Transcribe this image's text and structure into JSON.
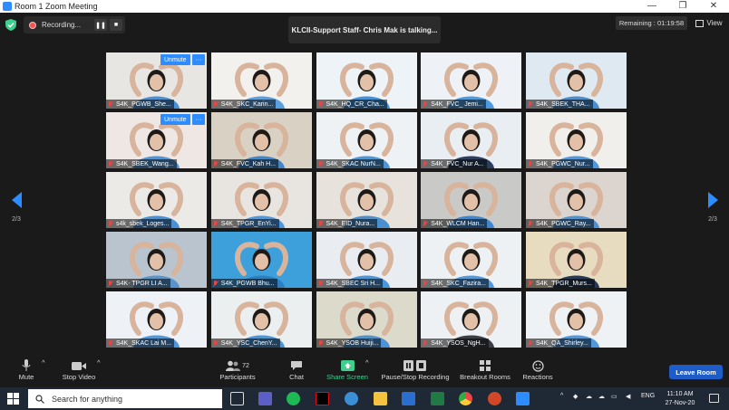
{
  "window": {
    "title": "Room 1   Zoom Meeting"
  },
  "top": {
    "recording_label": "Recording...",
    "talking_banner": "KLCII-Support Staff- Chris Mak is talking...",
    "remaining": "Remaining : 01:19:58",
    "view_label": "View"
  },
  "nav": {
    "page_left": "2/3",
    "page_right": "2/3"
  },
  "participants": [
    {
      "name": "S4K_PGWB_She...",
      "unmute": "Unmute",
      "more": "···",
      "bg": "#e8e6e2",
      "shirt": "#4a90d9"
    },
    {
      "name": "S4K_SKC_Karin...",
      "bg": "#f3f1ee",
      "shirt": "#5aa0e0"
    },
    {
      "name": "S4K_HQ_CR_Cha...",
      "bg": "#eef3f7",
      "shirt": "#3d92e0"
    },
    {
      "name": "S4K_FVC_ Jemi...",
      "bg": "#eef2f6",
      "shirt": "#4b9be3"
    },
    {
      "name": "S4K_SBEK_THA...",
      "bg": "#dfe9f2",
      "shirt": "#4a8ed0"
    },
    {
      "name": "S4K_SBEK_Wang...",
      "unmute": "Unmute",
      "more": "···",
      "bg": "#efe7e4",
      "shirt": "#4e94d8"
    },
    {
      "name": "S4K_FVC_Kah H...",
      "bg": "#d9d1c4",
      "shirt": "#3f86cc"
    },
    {
      "name": "S4K_SKAC NurN...",
      "bg": "#eef2f5",
      "shirt": "#4a94da"
    },
    {
      "name": "S4K_FVC_Nur A...",
      "bg": "#e9eef2",
      "shirt": "#2c3e60"
    },
    {
      "name": "S4K_PGWC_Nur...",
      "bg": "#f1efec",
      "shirt": "#4f98dd"
    },
    {
      "name": "s4k_sbek_Loges...",
      "bg": "#eceae7",
      "shirt": "#4a90d9"
    },
    {
      "name": "S4K_TPGR_EnYi...",
      "bg": "#e8e4df",
      "shirt": "#4e98de"
    },
    {
      "name": "S4K_EID_Nura...",
      "bg": "#e7e3dc",
      "shirt": "#4b8fcf"
    },
    {
      "name": "S4K_WLCM Han...",
      "bg": "#c9c9c7",
      "shirt": "#3b87d4"
    },
    {
      "name": "S4K_PGWC_Ray...",
      "bg": "#dcd4ce",
      "shirt": "#4b93d6"
    },
    {
      "name": "S4K- TPGR LI A...",
      "bg": "#b9c4cf",
      "shirt": "#5a94cc"
    },
    {
      "name": "S4K_PGWB Bhu...",
      "bg": "#3da0da",
      "shirt": "#2f7fc0"
    },
    {
      "name": "S4K_SBEC Sri H...",
      "bg": "#e9edf1",
      "shirt": "#4b96db"
    },
    {
      "name": "S4K_SKC_Fazira...",
      "bg": "#edf1f4",
      "shirt": "#4f9ae0"
    },
    {
      "name": "S4K_TPGR_Murs...",
      "bg": "#e8dcc0",
      "shirt": "#273b58"
    },
    {
      "name": "S4K_SKAC Lai M...",
      "bg": "#eef2f6",
      "shirt": "#4f98dd"
    },
    {
      "name": "S4K_YSC_ChenY...",
      "bg": "#ecefef",
      "shirt": "#4b95da"
    },
    {
      "name": "S4K_YSOB Huiji...",
      "bg": "#dcdacb",
      "shirt": "#4d92d2"
    },
    {
      "name": "S4K_YSOS_NgH...",
      "bg": "#eef1f4",
      "shirt": "#3b3f45"
    },
    {
      "name": "S4K_QA_Shirley...",
      "bg": "#eef2f5",
      "shirt": "#4f98dd"
    }
  ],
  "toolbar": {
    "mute": "Mute",
    "stop_video": "Stop Video",
    "participants": "Participants",
    "participants_count": "72",
    "chat": "Chat",
    "share_screen": "Share Screen",
    "pause_recording": "Pause/Stop Recording",
    "breakout_rooms": "Breakout Rooms",
    "reactions": "Reactions",
    "leave_room": "Leave Room",
    "caret": "^"
  },
  "taskbar": {
    "search_placeholder": "Search for anything",
    "language": "ENG",
    "time": "11:10 AM",
    "date": "27-Nov-20",
    "tray_caret": "^"
  },
  "colors": {
    "accent": "#2d8cff",
    "leave": "#1e5cc7",
    "share_green": "#3ecf8e",
    "muted_red": "#e44444"
  }
}
